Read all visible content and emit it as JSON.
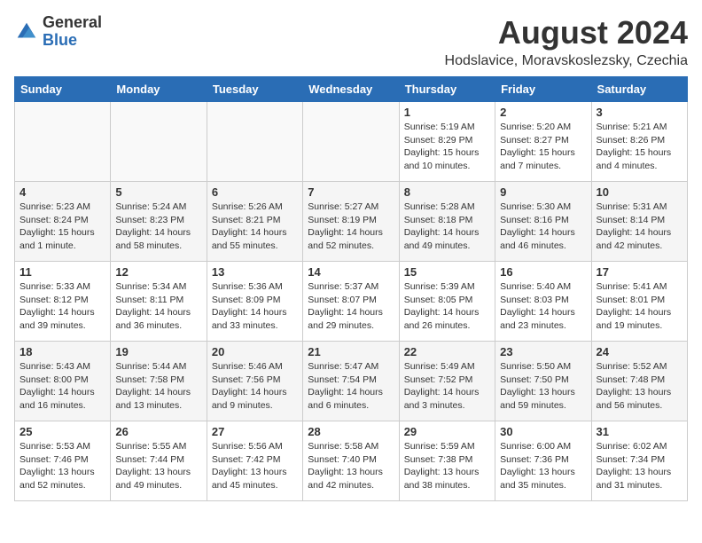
{
  "header": {
    "logo": {
      "general": "General",
      "blue": "Blue"
    },
    "month_year": "August 2024",
    "location": "Hodslavice, Moravskoslezsky, Czechia"
  },
  "weekdays": [
    "Sunday",
    "Monday",
    "Tuesday",
    "Wednesday",
    "Thursday",
    "Friday",
    "Saturday"
  ],
  "weeks": [
    [
      {
        "day": "",
        "info": ""
      },
      {
        "day": "",
        "info": ""
      },
      {
        "day": "",
        "info": ""
      },
      {
        "day": "",
        "info": ""
      },
      {
        "day": "1",
        "info": "Sunrise: 5:19 AM\nSunset: 8:29 PM\nDaylight: 15 hours\nand 10 minutes."
      },
      {
        "day": "2",
        "info": "Sunrise: 5:20 AM\nSunset: 8:27 PM\nDaylight: 15 hours\nand 7 minutes."
      },
      {
        "day": "3",
        "info": "Sunrise: 5:21 AM\nSunset: 8:26 PM\nDaylight: 15 hours\nand 4 minutes."
      }
    ],
    [
      {
        "day": "4",
        "info": "Sunrise: 5:23 AM\nSunset: 8:24 PM\nDaylight: 15 hours\nand 1 minute."
      },
      {
        "day": "5",
        "info": "Sunrise: 5:24 AM\nSunset: 8:23 PM\nDaylight: 14 hours\nand 58 minutes."
      },
      {
        "day": "6",
        "info": "Sunrise: 5:26 AM\nSunset: 8:21 PM\nDaylight: 14 hours\nand 55 minutes."
      },
      {
        "day": "7",
        "info": "Sunrise: 5:27 AM\nSunset: 8:19 PM\nDaylight: 14 hours\nand 52 minutes."
      },
      {
        "day": "8",
        "info": "Sunrise: 5:28 AM\nSunset: 8:18 PM\nDaylight: 14 hours\nand 49 minutes."
      },
      {
        "day": "9",
        "info": "Sunrise: 5:30 AM\nSunset: 8:16 PM\nDaylight: 14 hours\nand 46 minutes."
      },
      {
        "day": "10",
        "info": "Sunrise: 5:31 AM\nSunset: 8:14 PM\nDaylight: 14 hours\nand 42 minutes."
      }
    ],
    [
      {
        "day": "11",
        "info": "Sunrise: 5:33 AM\nSunset: 8:12 PM\nDaylight: 14 hours\nand 39 minutes."
      },
      {
        "day": "12",
        "info": "Sunrise: 5:34 AM\nSunset: 8:11 PM\nDaylight: 14 hours\nand 36 minutes."
      },
      {
        "day": "13",
        "info": "Sunrise: 5:36 AM\nSunset: 8:09 PM\nDaylight: 14 hours\nand 33 minutes."
      },
      {
        "day": "14",
        "info": "Sunrise: 5:37 AM\nSunset: 8:07 PM\nDaylight: 14 hours\nand 29 minutes."
      },
      {
        "day": "15",
        "info": "Sunrise: 5:39 AM\nSunset: 8:05 PM\nDaylight: 14 hours\nand 26 minutes."
      },
      {
        "day": "16",
        "info": "Sunrise: 5:40 AM\nSunset: 8:03 PM\nDaylight: 14 hours\nand 23 minutes."
      },
      {
        "day": "17",
        "info": "Sunrise: 5:41 AM\nSunset: 8:01 PM\nDaylight: 14 hours\nand 19 minutes."
      }
    ],
    [
      {
        "day": "18",
        "info": "Sunrise: 5:43 AM\nSunset: 8:00 PM\nDaylight: 14 hours\nand 16 minutes."
      },
      {
        "day": "19",
        "info": "Sunrise: 5:44 AM\nSunset: 7:58 PM\nDaylight: 14 hours\nand 13 minutes."
      },
      {
        "day": "20",
        "info": "Sunrise: 5:46 AM\nSunset: 7:56 PM\nDaylight: 14 hours\nand 9 minutes."
      },
      {
        "day": "21",
        "info": "Sunrise: 5:47 AM\nSunset: 7:54 PM\nDaylight: 14 hours\nand 6 minutes."
      },
      {
        "day": "22",
        "info": "Sunrise: 5:49 AM\nSunset: 7:52 PM\nDaylight: 14 hours\nand 3 minutes."
      },
      {
        "day": "23",
        "info": "Sunrise: 5:50 AM\nSunset: 7:50 PM\nDaylight: 13 hours\nand 59 minutes."
      },
      {
        "day": "24",
        "info": "Sunrise: 5:52 AM\nSunset: 7:48 PM\nDaylight: 13 hours\nand 56 minutes."
      }
    ],
    [
      {
        "day": "25",
        "info": "Sunrise: 5:53 AM\nSunset: 7:46 PM\nDaylight: 13 hours\nand 52 minutes."
      },
      {
        "day": "26",
        "info": "Sunrise: 5:55 AM\nSunset: 7:44 PM\nDaylight: 13 hours\nand 49 minutes."
      },
      {
        "day": "27",
        "info": "Sunrise: 5:56 AM\nSunset: 7:42 PM\nDaylight: 13 hours\nand 45 minutes."
      },
      {
        "day": "28",
        "info": "Sunrise: 5:58 AM\nSunset: 7:40 PM\nDaylight: 13 hours\nand 42 minutes."
      },
      {
        "day": "29",
        "info": "Sunrise: 5:59 AM\nSunset: 7:38 PM\nDaylight: 13 hours\nand 38 minutes."
      },
      {
        "day": "30",
        "info": "Sunrise: 6:00 AM\nSunset: 7:36 PM\nDaylight: 13 hours\nand 35 minutes."
      },
      {
        "day": "31",
        "info": "Sunrise: 6:02 AM\nSunset: 7:34 PM\nDaylight: 13 hours\nand 31 minutes."
      }
    ]
  ]
}
